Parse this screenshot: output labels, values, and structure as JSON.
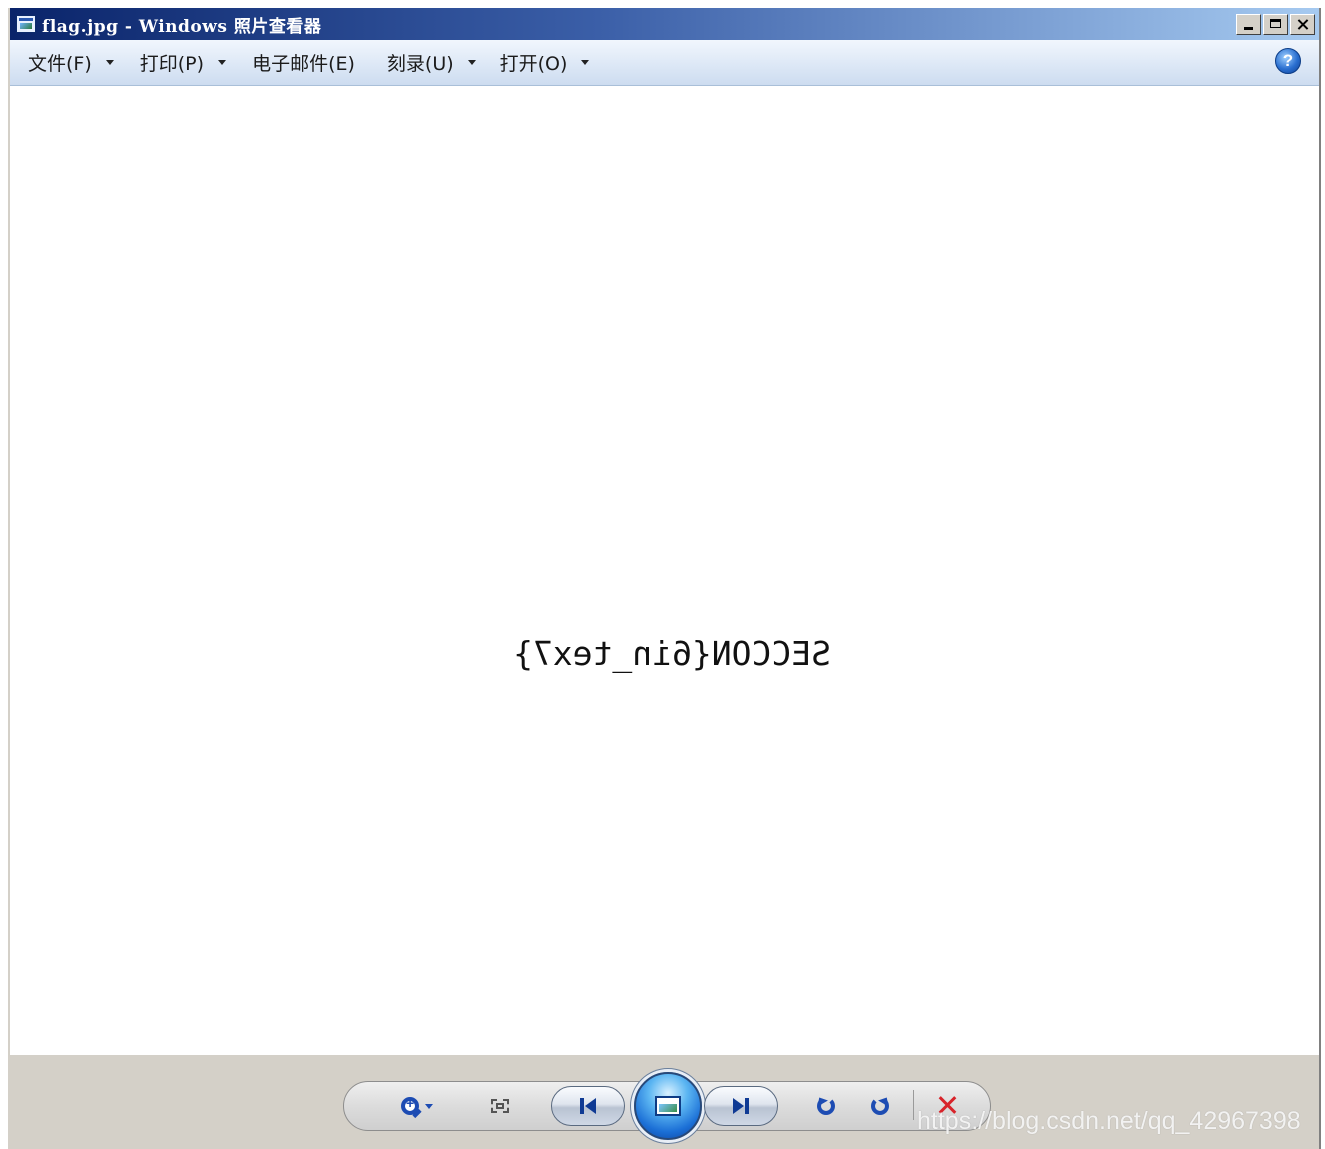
{
  "window": {
    "title": "flag.jpg - Windows 照片查看器"
  },
  "menu": {
    "items": [
      {
        "label": "文件(F)",
        "has_dropdown": true
      },
      {
        "label": "打印(P)",
        "has_dropdown": true
      },
      {
        "label": "电子邮件(E)",
        "has_dropdown": false
      },
      {
        "label": "刻录(U)",
        "has_dropdown": true
      },
      {
        "label": "打开(O)",
        "has_dropdown": true
      }
    ],
    "help_label": "?"
  },
  "image": {
    "mirrored_text": "SECCON{6in_tex7}"
  },
  "controls": {
    "icons": [
      "zoom-icon",
      "fit-window-icon",
      "previous-icon",
      "slideshow-icon",
      "next-icon",
      "rotate-counterclockwise-icon",
      "rotate-clockwise-icon",
      "delete-icon"
    ]
  },
  "watermark": "https://blog.csdn.net/qq_42967398",
  "colors": {
    "titlebar_start": "#0a246a",
    "titlebar_end": "#a6caf0",
    "toolbar_bg": "#dde8f6",
    "bottom_bg": "#d4d0c8",
    "accent_blue": "#1d4cb3",
    "delete_red": "#d8232a"
  }
}
